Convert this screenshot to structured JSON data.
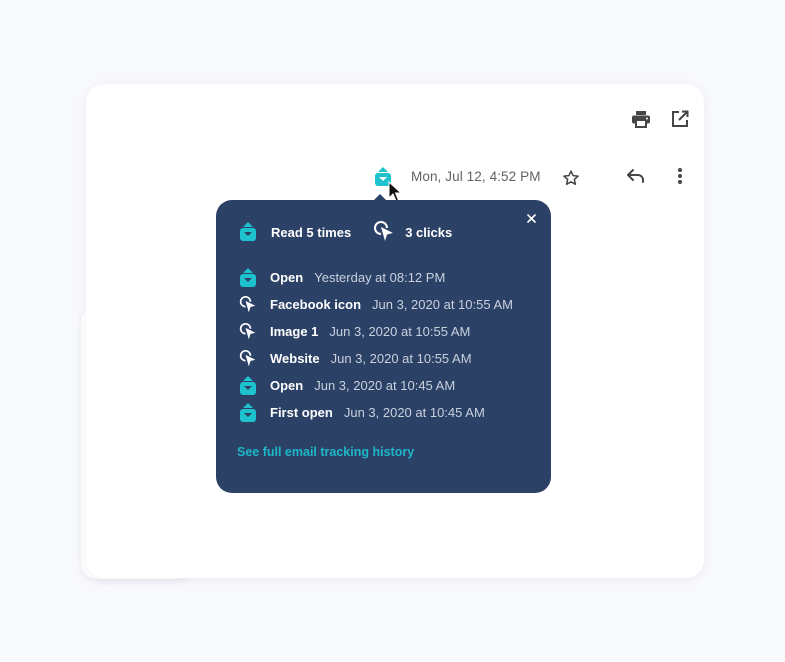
{
  "colors": {
    "background": "#f8f9fd",
    "card": "#ffffff",
    "popup": "#2c4166",
    "accent": "#1eb7c9",
    "header_icon": "#444746"
  },
  "header": {
    "icons": [
      "print-icon",
      "open-in-new-window-icon"
    ]
  },
  "message": {
    "tracking_icon": "email-opened-tracker-icon",
    "date": "Mon, Jul 12, 4:52 PM",
    "actions": [
      "star-icon",
      "reply-icon",
      "more-options-icon"
    ]
  },
  "popup": {
    "close_icon": "close-icon",
    "summary": {
      "reads": "Read 5 times",
      "clicks": "3 clicks"
    },
    "events": [
      {
        "type": "open",
        "icon": "envelope-open-icon",
        "label": "Open",
        "time": "Yesterday at 08:12 PM"
      },
      {
        "type": "click",
        "icon": "click-icon",
        "label": "Facebook icon",
        "time": "Jun 3, 2020 at 10:55 AM"
      },
      {
        "type": "click",
        "icon": "click-icon",
        "label": "Image 1",
        "time": "Jun 3, 2020 at 10:55 AM"
      },
      {
        "type": "click",
        "icon": "click-icon",
        "label": "Website",
        "time": "Jun 3, 2020 at 10:55 AM"
      },
      {
        "type": "open",
        "icon": "envelope-open-icon",
        "label": "Open",
        "time": "Jun 3, 2020 at 10:45 AM"
      },
      {
        "type": "open",
        "icon": "envelope-open-icon",
        "label": "First open",
        "time": "Jun 3, 2020 at 10:45 AM"
      }
    ],
    "history_link": "See full email tracking history"
  }
}
